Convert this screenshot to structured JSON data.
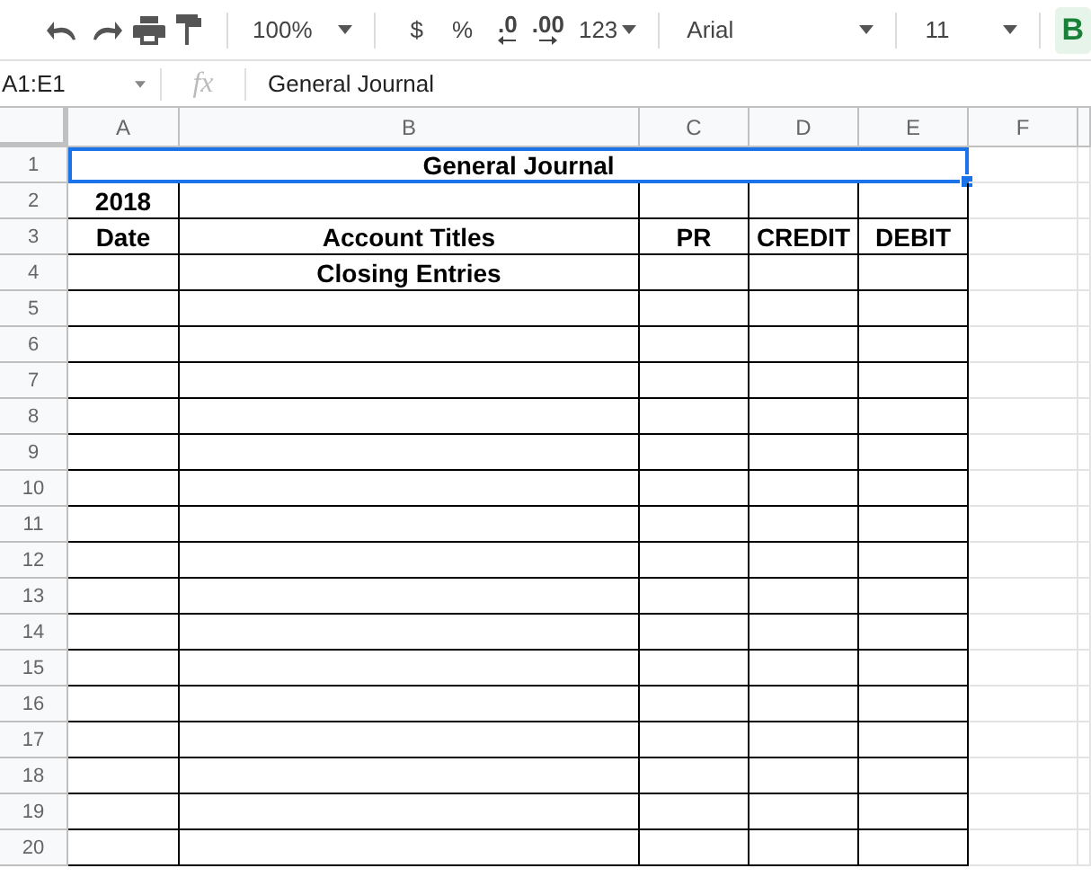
{
  "toolbar": {
    "zoom": "100%",
    "currency": "$",
    "percent": "%",
    "decrease_decimals": ".0",
    "increase_decimals": ".00",
    "more_formats": "123",
    "font": "Arial",
    "font_size": "11",
    "bold": {
      "label": "B",
      "on": true
    }
  },
  "formula_bar": {
    "name_box": "A1:E1",
    "fx": "fx",
    "value": "General Journal"
  },
  "columns": [
    "A",
    "B",
    "C",
    "D",
    "E",
    "F"
  ],
  "rows": [
    {
      "number": "1",
      "merged_cell": {
        "text": "General Journal",
        "selected": true
      }
    },
    {
      "number": "2",
      "cells": {
        "A": "2018"
      }
    },
    {
      "number": "3",
      "cells": {
        "A": "Date",
        "B": "Account Titles",
        "C": "PR",
        "D": "CREDIT",
        "E": "DEBIT"
      }
    },
    {
      "number": "4",
      "cells": {
        "B": "Closing Entries"
      }
    },
    {
      "number": "5"
    },
    {
      "number": "6"
    },
    {
      "number": "7"
    },
    {
      "number": "8"
    },
    {
      "number": "9"
    },
    {
      "number": "10"
    },
    {
      "number": "11"
    },
    {
      "number": "12"
    },
    {
      "number": "13"
    },
    {
      "number": "14"
    },
    {
      "number": "15"
    },
    {
      "number": "16"
    },
    {
      "number": "17"
    },
    {
      "number": "18"
    },
    {
      "number": "19"
    },
    {
      "number": "20"
    }
  ]
}
